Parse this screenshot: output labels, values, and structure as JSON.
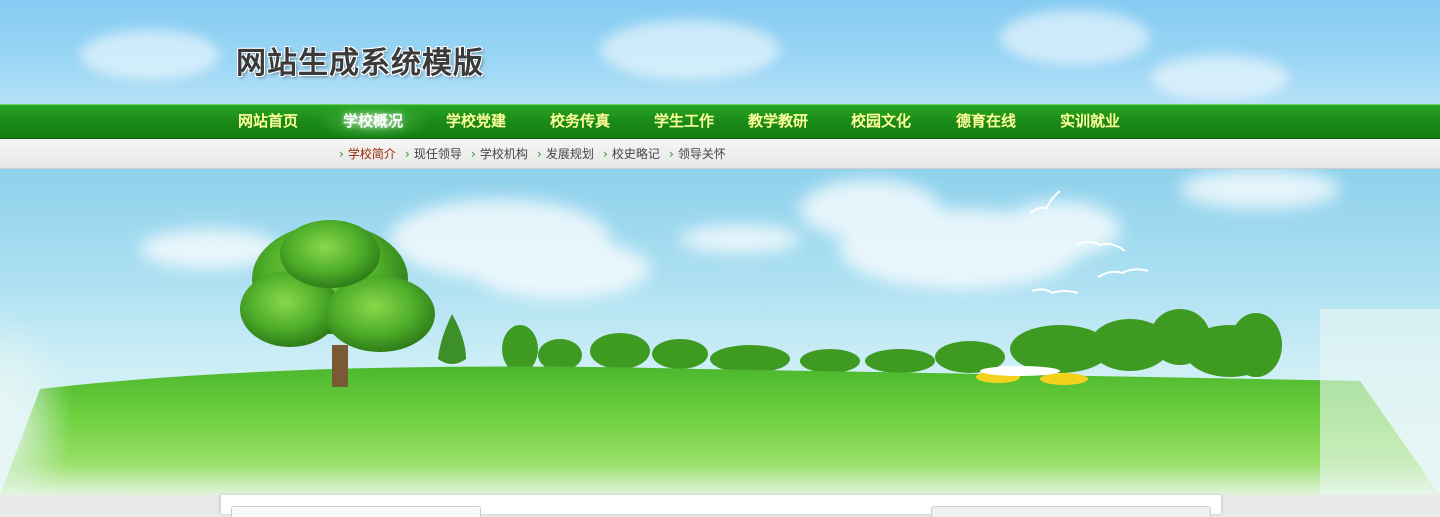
{
  "header": {
    "site_title": "网站生成系统模版"
  },
  "nav": {
    "items": [
      {
        "label": "网站首页",
        "active": false
      },
      {
        "label": "学校概况",
        "active": true
      },
      {
        "label": "学校党建",
        "active": false
      },
      {
        "label": "校务传真",
        "active": false
      },
      {
        "label": "学生工作",
        "active": false
      },
      {
        "label": "教学教研",
        "active": false
      },
      {
        "label": "校园文化",
        "active": false
      },
      {
        "label": "德育在线",
        "active": false
      },
      {
        "label": "实训就业",
        "active": false
      }
    ]
  },
  "subnav": {
    "arrow": "›",
    "items": [
      {
        "label": "学校简介",
        "active": true
      },
      {
        "label": "现任领导",
        "active": false
      },
      {
        "label": "学校机构",
        "active": false
      },
      {
        "label": "发展规划",
        "active": false
      },
      {
        "label": "校史略记",
        "active": false
      },
      {
        "label": "领导关怀",
        "active": false
      }
    ]
  },
  "colors": {
    "nav_green": "#1a8a18",
    "nav_text": "#ffff99",
    "sub_active": "#9a2a00",
    "grass": "#5cc43a"
  },
  "banner": {
    "scene": "landscape-illustration"
  }
}
